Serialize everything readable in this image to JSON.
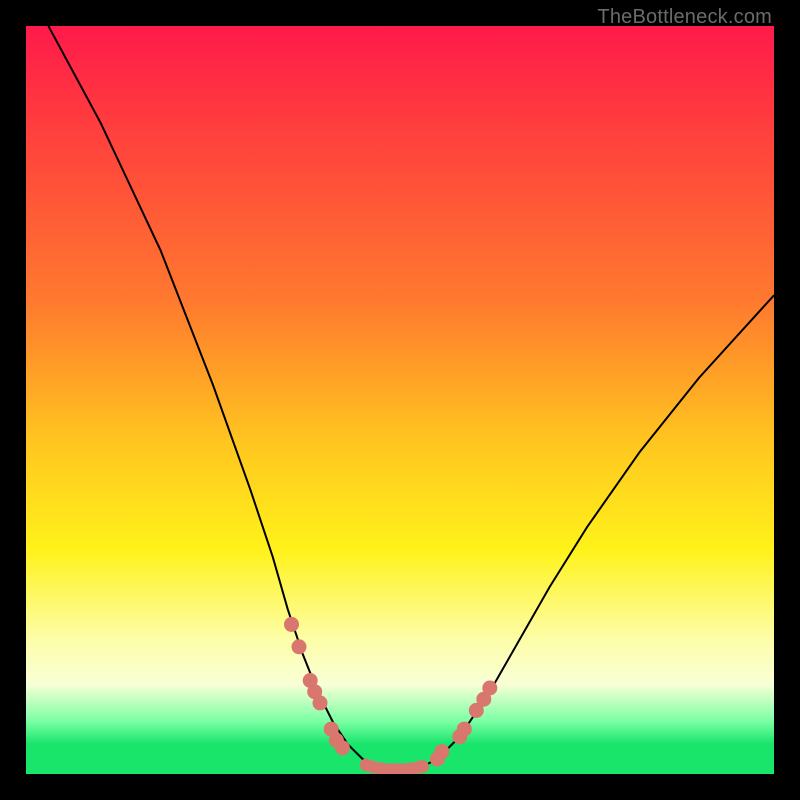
{
  "watermark": "TheBottleneck.com",
  "chart_data": {
    "type": "line",
    "title": "",
    "xlabel": "",
    "ylabel": "",
    "xlim": [
      0,
      100
    ],
    "ylim": [
      0,
      100
    ],
    "curve": {
      "name": "bottleneck-curve",
      "x": [
        3,
        10,
        18,
        25,
        30,
        33,
        35,
        37,
        39,
        41,
        43,
        45,
        47,
        49,
        51,
        53,
        55,
        58,
        62,
        66,
        70,
        75,
        82,
        90,
        100
      ],
      "y": [
        100,
        87,
        70,
        52,
        38,
        29,
        22,
        16,
        11,
        7,
        4,
        2,
        1,
        0.5,
        0.5,
        1,
        2,
        5,
        11,
        18,
        25,
        33,
        43,
        53,
        64
      ]
    },
    "markers_left": {
      "name": "left-branch-points",
      "x": [
        35.5,
        36.5,
        38.0,
        38.6,
        39.3,
        40.8,
        41.5,
        42.3
      ],
      "y": [
        20.0,
        17.0,
        12.5,
        11.0,
        9.5,
        6.0,
        4.5,
        3.5
      ]
    },
    "markers_right": {
      "name": "right-branch-points",
      "x": [
        55.0,
        55.6,
        58.0,
        58.6,
        60.2,
        61.2,
        62.0
      ],
      "y": [
        2.0,
        3.0,
        5.0,
        6.0,
        8.5,
        10.0,
        11.5
      ]
    },
    "markers_bottom": {
      "name": "trough-points",
      "x": [
        45.5,
        46.5,
        47.5,
        48.5,
        49.5,
        50.5,
        51.5,
        52.5,
        53.0
      ],
      "y": [
        1.2,
        0.9,
        0.7,
        0.6,
        0.6,
        0.6,
        0.7,
        0.9,
        1.0
      ]
    }
  }
}
